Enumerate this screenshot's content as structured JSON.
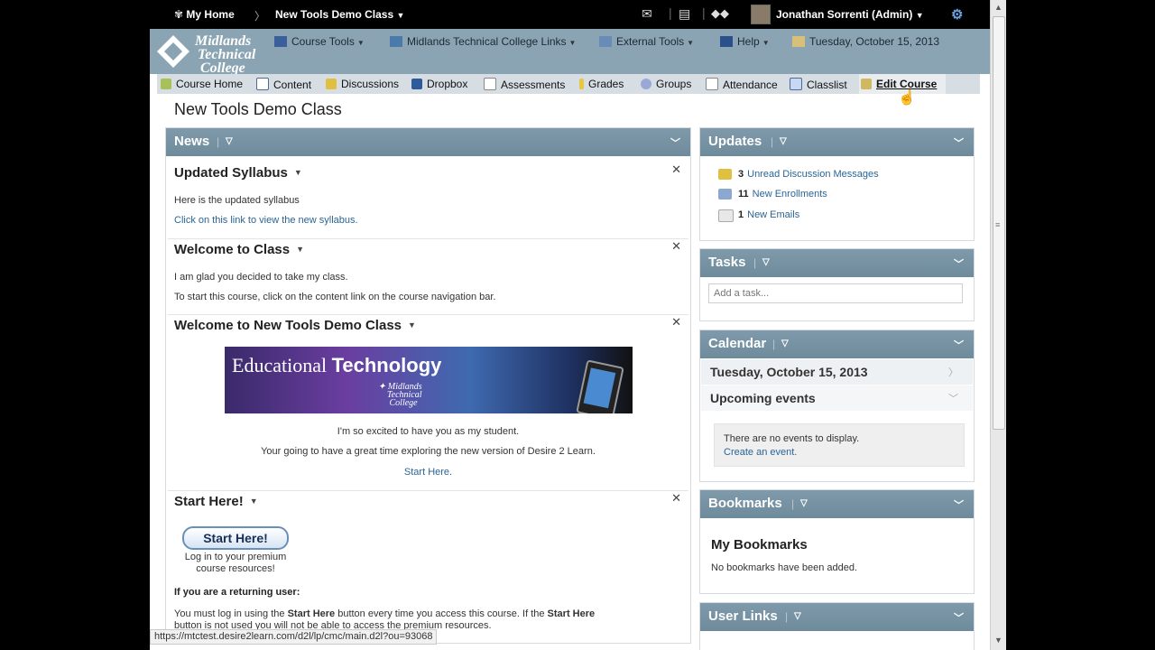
{
  "topbar": {
    "home": "My Home",
    "course": "New Tools Demo Class",
    "user": "Jonathan Sorrenti (Admin)"
  },
  "header": {
    "logo_lines": [
      "Midlands",
      "Technical",
      "College"
    ],
    "menus": [
      "Course Tools",
      "Midlands Technical College Links",
      "External Tools",
      "Help"
    ],
    "date": "Tuesday, October 15, 2013"
  },
  "course_nav": [
    "Course Home",
    "Content",
    "Discussions",
    "Dropbox",
    "Assessments",
    "Grades",
    "Groups",
    "Attendance",
    "Classlist",
    "Edit Course"
  ],
  "page_title": "New Tools Demo Class",
  "news": {
    "title": "News",
    "items": [
      {
        "title": "Updated Syllabus",
        "lines": [
          "Here is the updated syllabus"
        ],
        "link": "Click on this link to view the new syllabus."
      },
      {
        "title": "Welcome to Class",
        "lines": [
          "I am glad you decided to take my class.",
          "To start this course, click on the content link on the course navigation bar."
        ]
      },
      {
        "title": "Welcome to New Tools Demo Class",
        "banner_title": "Educational",
        "banner_title_bold": "Technology",
        "banner_sub": [
          "Midlands",
          "Technical",
          "College"
        ],
        "lines": [
          "I'm so excited to have you as my student.",
          "Your going to have a great time exploring the new version of Desire 2 Learn."
        ],
        "link": "Start Here."
      },
      {
        "title": "Start Here!",
        "button": "Start Here!",
        "button_caption": [
          "Log in to your premium",
          "course resources!"
        ],
        "returning": "If you are a returning user:",
        "para": [
          "You must log in using the ",
          "Start Here",
          " button every time you access this course. If the ",
          "Start Here"
        ],
        "para2": "button is not used you will not be able to access the premium resources."
      }
    ]
  },
  "updates": {
    "title": "Updates",
    "items": [
      {
        "count": "3",
        "label": "Unread Discussion Messages"
      },
      {
        "count": "11",
        "label": "New Enrollments"
      },
      {
        "count": "1",
        "label": "New Emails"
      }
    ]
  },
  "tasks": {
    "title": "Tasks",
    "placeholder": "Add a task..."
  },
  "calendar": {
    "title": "Calendar",
    "date": "Tuesday, October 15, 2013",
    "upcoming": "Upcoming events",
    "empty": "There are no events to display.",
    "create": "Create an event."
  },
  "bookmarks": {
    "title": "Bookmarks",
    "heading": "My Bookmarks",
    "empty": "No bookmarks have been added."
  },
  "userlinks": {
    "title": "User Links"
  },
  "status_url": "https://mtctest.desire2learn.com/d2l/lp/cmc/main.d2l?ou=93068"
}
